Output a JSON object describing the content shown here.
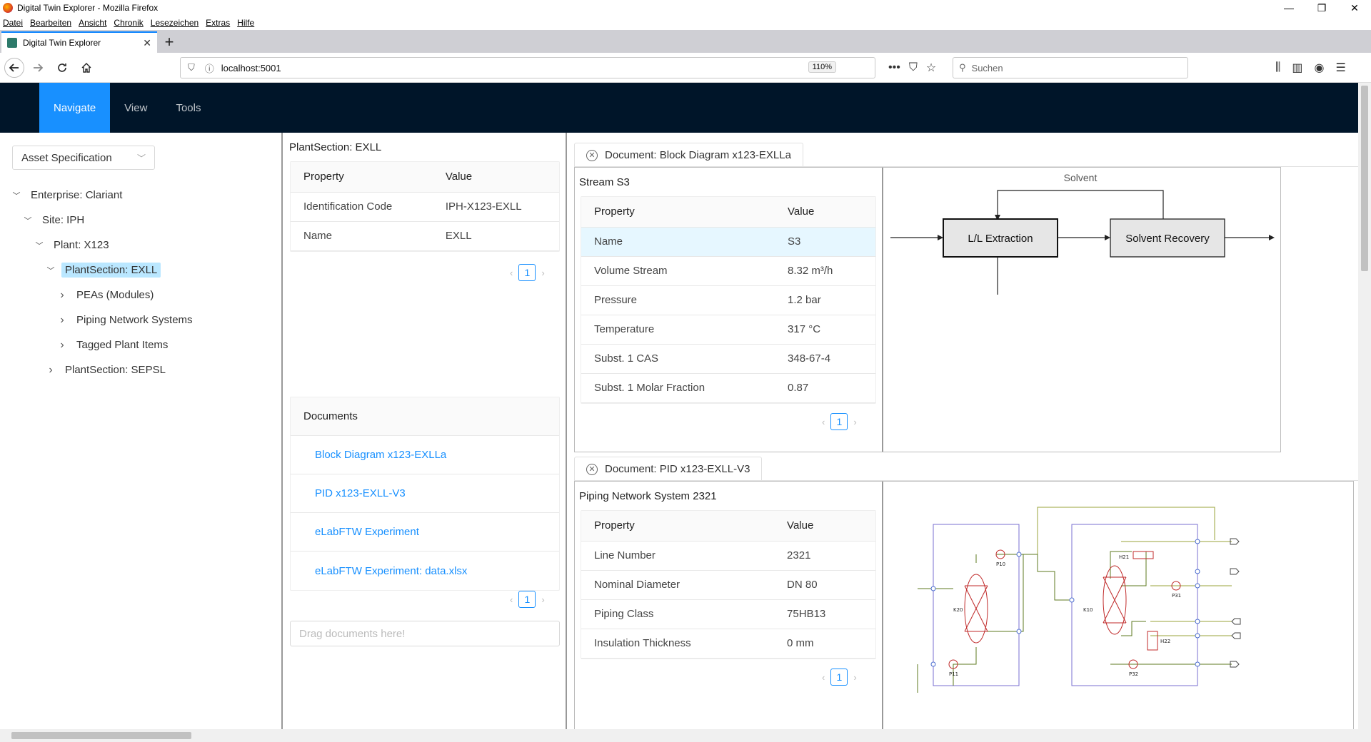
{
  "browser": {
    "window_title": "Digital Twin Explorer - Mozilla Firefox",
    "menu": [
      "Datei",
      "Bearbeiten",
      "Ansicht",
      "Chronik",
      "Lesezeichen",
      "Extras",
      "Hilfe"
    ],
    "tab_title": "Digital Twin Explorer",
    "url": "localhost:5001",
    "zoom": "110%",
    "search_placeholder": "Suchen"
  },
  "header": {
    "items": [
      "Navigate",
      "View",
      "Tools"
    ],
    "active": "Navigate"
  },
  "left": {
    "select_value": "Asset Specification",
    "tree": [
      {
        "label": "Enterprise: Clariant",
        "level": 0,
        "expanded": true
      },
      {
        "label": "Site: IPH",
        "level": 1,
        "expanded": true
      },
      {
        "label": "Plant: X123",
        "level": 2,
        "expanded": true
      },
      {
        "label": "PlantSection: EXLL",
        "level": 3,
        "expanded": true,
        "selected": true
      },
      {
        "label": "PEAs (Modules)",
        "level": 4,
        "expanded": false
      },
      {
        "label": "Piping Network Systems",
        "level": 4,
        "expanded": false
      },
      {
        "label": "Tagged Plant Items",
        "level": 4,
        "expanded": false
      },
      {
        "label": "PlantSection: SEPSL",
        "level": 3,
        "expanded": false
      }
    ]
  },
  "middle": {
    "title": "PlantSection: EXLL",
    "table": {
      "headers": [
        "Property",
        "Value"
      ],
      "rows": [
        [
          "Identification Code",
          "IPH-X123-EXLL"
        ],
        [
          "Name",
          "EXLL"
        ]
      ]
    },
    "page": "1",
    "documents_header": "Documents",
    "documents": [
      "Block Diagram x123-EXLLa",
      "PID x123-EXLL-V3",
      "eLabFTW Experiment",
      "eLabFTW Experiment: data.xlsx"
    ],
    "documents_page": "1",
    "drop_placeholder": "Drag documents here!"
  },
  "right": {
    "doc1": {
      "tab": "Document: Block Diagram x123-EXLLa",
      "title": "Stream S3",
      "headers": [
        "Property",
        "Value"
      ],
      "rows": [
        [
          "Name",
          "S3"
        ],
        [
          "Volume Stream",
          "8.32 m³/h"
        ],
        [
          "Pressure",
          "1.2 bar"
        ],
        [
          "Temperature",
          "317 °C"
        ],
        [
          "Subst. 1 CAS",
          "348-67-4"
        ],
        [
          "Subst. 1 Molar Fraction",
          "0.87"
        ]
      ],
      "page": "1",
      "diagram": {
        "solvent_label": "Solvent",
        "box1": "L/L Extraction",
        "box2": "Solvent Recovery"
      }
    },
    "doc2": {
      "tab": "Document: PID x123-EXLL-V3",
      "title": "Piping Network System 2321",
      "headers": [
        "Property",
        "Value"
      ],
      "rows": [
        [
          "Line Number",
          "2321"
        ],
        [
          "Nominal Diameter",
          "DN 80"
        ],
        [
          "Piping Class",
          "75HB13"
        ],
        [
          "Insulation Thickness",
          "0 mm"
        ]
      ],
      "page": "1",
      "pid_labels": [
        "K20",
        "P10",
        "P11",
        "K10",
        "H21",
        "P31",
        "H22",
        "P32"
      ]
    }
  }
}
